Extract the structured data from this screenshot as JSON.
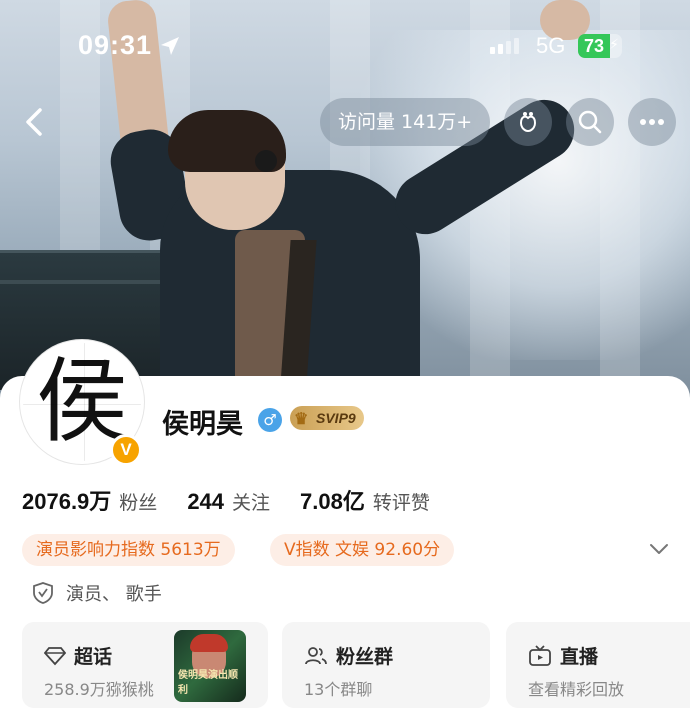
{
  "status_bar": {
    "time": "09:31",
    "network": "5G",
    "battery": "73",
    "battery_level": 0.73
  },
  "nav": {
    "visits_label": "访问量 141万+"
  },
  "profile": {
    "avatar_glyph": "侯",
    "verify_badge": "V",
    "name": "侯明昊",
    "gender_symbol": "♂",
    "vip_label": "SVIP9"
  },
  "stats": [
    {
      "value": "2076.9万",
      "label": "粉丝"
    },
    {
      "value": "244",
      "label": "关注"
    },
    {
      "value": "7.08亿",
      "label": "转评赞"
    }
  ],
  "pills": [
    {
      "text": "演员影响力指数 5613万"
    },
    {
      "text": "V指数 文娱 92.60分"
    }
  ],
  "role": "演员、 歌手",
  "tiles": [
    {
      "title": "超话",
      "subtitle": "258.9万猕猴桃",
      "thumb_caption": "侯明昊演出顺利"
    },
    {
      "title": "粉丝群",
      "subtitle": "13个群聊"
    },
    {
      "title": "直播",
      "subtitle": "查看精彩回放"
    }
  ],
  "colors": {
    "accent_orange": "#e66a1e",
    "pill_bg": "#fdeee6",
    "battery_green": "#35c759",
    "gender_blue": "#4aa3e8",
    "verify_gold": "#f7a300"
  },
  "icons": [
    "location-arrow-icon",
    "back-chevron-icon",
    "pet-icon",
    "search-icon",
    "more-icon",
    "chevron-down-icon",
    "shield-icon",
    "diamond-icon",
    "people-icon",
    "live-tv-icon"
  ]
}
